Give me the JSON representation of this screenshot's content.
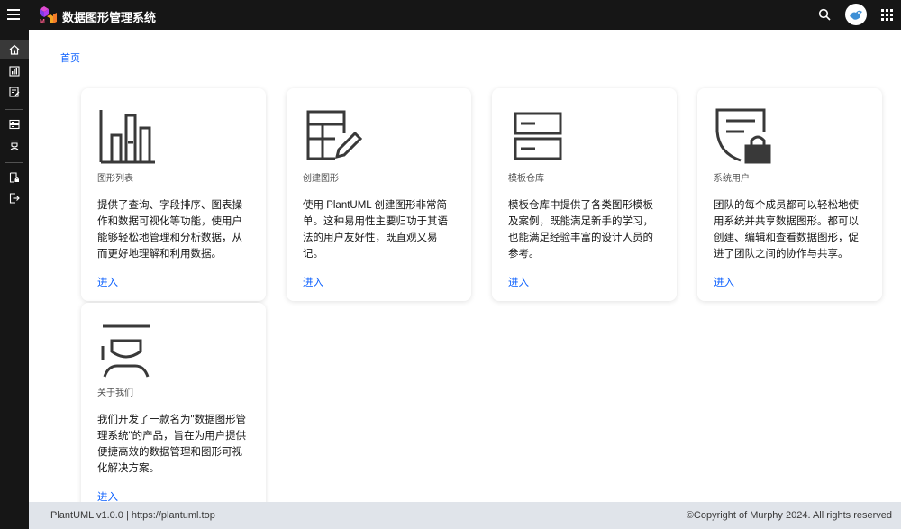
{
  "header": {
    "app_title": "数据图形管理系统",
    "icons": [
      "menu-icon",
      "logo",
      "search-icon",
      "avatar",
      "app-switcher-icon"
    ]
  },
  "sidebar": {
    "items": [
      "home-icon",
      "chart-icon",
      "report-icon",
      "server-icon",
      "user-role-icon",
      "file-lock-icon",
      "logout-icon"
    ]
  },
  "breadcrumb": {
    "home": "首页"
  },
  "cards": [
    {
      "icon": "bar-chart-icon",
      "label": "图形列表",
      "desc": "提供了查询、字段排序、图表操作和数据可视化等功能，使用户能够轻松地管理和分析数据，从而更好地理解和利用数据。",
      "link": "进入"
    },
    {
      "icon": "table-edit-icon",
      "label": "创建图形",
      "desc": "使用 PlantUML 创建图形非常简单。这种易用性主要归功于其语法的用户友好性，既直观又易记。",
      "link": "进入"
    },
    {
      "icon": "server-stack-icon",
      "label": "模板仓库",
      "desc": "模板仓库中提供了各类图形模板及案例，既能满足新手的学习，也能满足经验丰富的设计人员的参考。",
      "link": "进入"
    },
    {
      "icon": "shield-lock-icon",
      "label": "系统用户",
      "desc": "团队的每个成员都可以轻松地使用系统并共享数据图形。都可以创建、编辑和查看数据图形，促进了团队之间的协作与共享。",
      "link": "进入"
    },
    {
      "icon": "person-icon",
      "label": "关于我们",
      "desc": "我们开发了一款名为\"数据图形管理系统\"的产品，旨在为用户提供便捷高效的数据管理和图形可视化解决方案。",
      "link": "进入"
    }
  ],
  "footer": {
    "left": "PlantUML v1.0.0 | https://plantuml.top",
    "right": "©Copyright of Murphy 2024. All rights reserved"
  },
  "colors": {
    "topbar": "#161616",
    "link": "#0f62fe",
    "footer": "#e0e4ea",
    "icon": "#525252"
  }
}
